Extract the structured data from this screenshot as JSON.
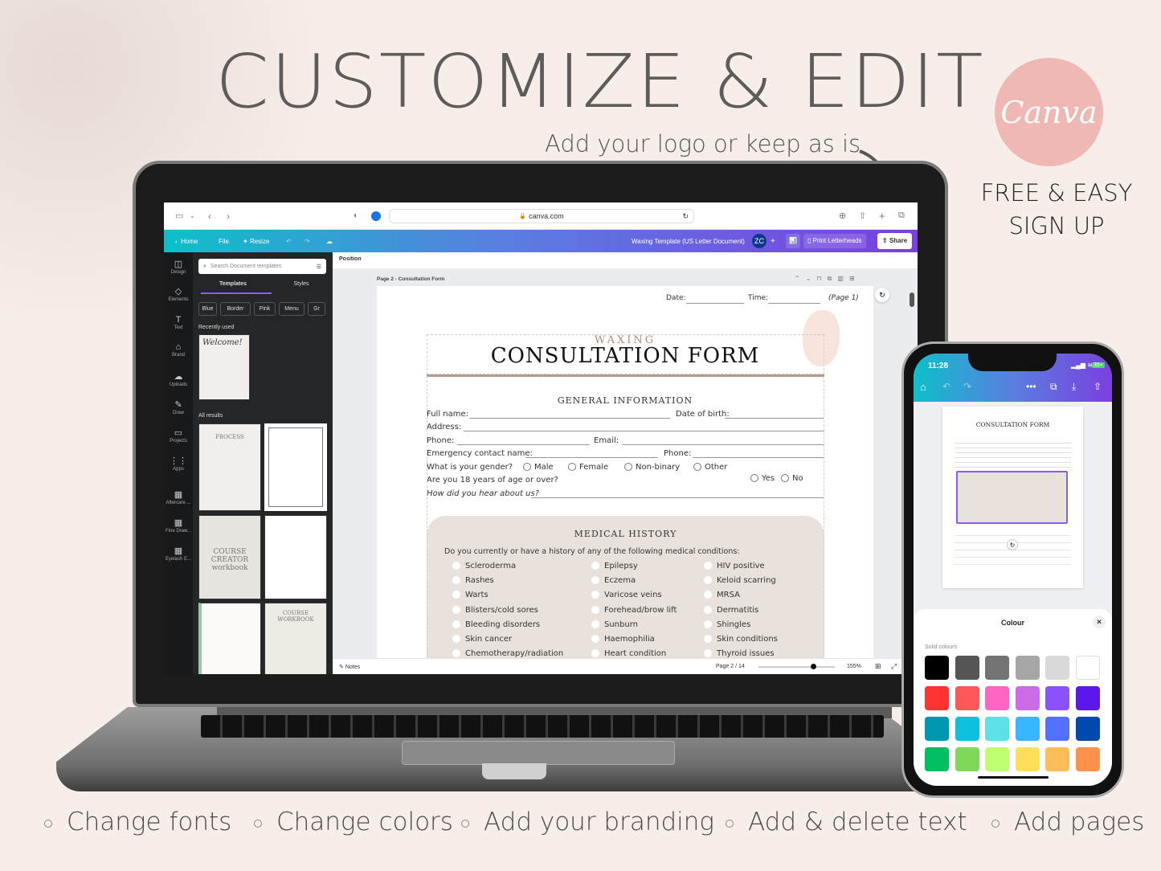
{
  "hero": {
    "headline": "CUSTOMIZE & EDIT",
    "subhead": "Add your logo or keep as is",
    "canva_logo": "Canva",
    "free_line1": "FREE & EASY",
    "free_line2": "SIGN UP"
  },
  "browser": {
    "url": "canva.com"
  },
  "canva_toolbar": {
    "home": "Home",
    "file": "File",
    "resize": "Resize",
    "doc_title": "Waxing Template (US Letter Document)",
    "avatar": "ZC",
    "print": "Print Letterheads",
    "share": "Share"
  },
  "rail": [
    {
      "label": "Design",
      "icon": "layout-icon"
    },
    {
      "label": "Elements",
      "icon": "shapes-icon"
    },
    {
      "label": "Text",
      "icon": "text-icon"
    },
    {
      "label": "Brand",
      "icon": "brand-icon"
    },
    {
      "label": "Uploads",
      "icon": "upload-icon"
    },
    {
      "label": "Draw",
      "icon": "pen-icon"
    },
    {
      "label": "Projects",
      "icon": "folder-icon"
    },
    {
      "label": "Apps",
      "icon": "apps-icon"
    },
    {
      "label": "Aftercare ...",
      "icon": "thumb-icon"
    },
    {
      "label": "Fine Draw...",
      "icon": "thumb-icon"
    },
    {
      "label": "Eyelash E...",
      "icon": "thumb-icon"
    }
  ],
  "panel": {
    "search_placeholder": "Search Document templates",
    "tabs": [
      "Templates",
      "Styles"
    ],
    "chips": [
      "Blue",
      "Border",
      "Pink",
      "Menu",
      "Gr"
    ],
    "recently_used": "Recently used",
    "recent_thumb": "Welcome!",
    "all_results": "All results",
    "thumbs": [
      "PROCESS",
      "",
      "COURSE CREATOR workbook",
      "",
      "",
      "COURSE WORKBOOK"
    ]
  },
  "editor": {
    "position": "Position",
    "page_label": "Page 2 - Consultation Form",
    "notes": "Notes",
    "page_count": "Page 2 / 14",
    "zoom": "155%",
    "zoom_fraction": 0.72
  },
  "form": {
    "date": "Date:",
    "time": "Time:",
    "page_ref": "(Page 1)",
    "kicker": "WAXING",
    "title": "CONSULTATION FORM",
    "general": "GENERAL INFORMATION",
    "full_name": "Full name:",
    "dob": "Date of birth:",
    "address": "Address:",
    "phone": "Phone:",
    "email": "Email:",
    "emergency": "Emergency contact name:",
    "phone2": "Phone:",
    "gender_q": "What is your gender?",
    "genders": [
      "Male",
      "Female",
      "Non-binary",
      "Other"
    ],
    "age_q": "Are you 18 years of age or over?",
    "yes": "Yes",
    "no": "No",
    "hear_q": "How did you hear about us?",
    "medical": "MEDICAL HISTORY",
    "medical_q": "Do you currently or have a history of any of the following medical conditions:",
    "col1": [
      "Scleroderma",
      "Rashes",
      "Warts",
      "Blisters/cold sores",
      "Bleeding disorders",
      "Skin cancer",
      "Chemotherapy/radiation"
    ],
    "col2": [
      "Epilepsy",
      "Eczema",
      "Varicose veins",
      "Forehead/brow lift",
      "Sunburn",
      "Haemophilia",
      "Heart condition"
    ],
    "col3": [
      "HIV positive",
      "Keloid scarring",
      "MRSA",
      "Dermatitis",
      "Shingles",
      "Skin conditions",
      "Thyroid issues"
    ]
  },
  "phone": {
    "time": "11:28",
    "battery": "35+",
    "sheet_title": "Colour",
    "solid_label": "Solid colours",
    "swatches": [
      "#000000",
      "#555555",
      "#737373",
      "#a6a6a6",
      "#d9d9d9",
      "#ffffff",
      "#ff3131",
      "#ff5757",
      "#ff66c4",
      "#cb6ce6",
      "#8c52ff",
      "#5e17eb",
      "#0097b2",
      "#0cc0df",
      "#5ce1e6",
      "#38b6ff",
      "#5271ff",
      "#004aad",
      "#00bf63",
      "#7ed957",
      "#c1ff72",
      "#ffde59",
      "#ffbd59",
      "#ff914d"
    ]
  },
  "features": [
    "Change fonts",
    "Change colors",
    "Add your branding",
    "Add & delete text",
    "Add pages"
  ]
}
